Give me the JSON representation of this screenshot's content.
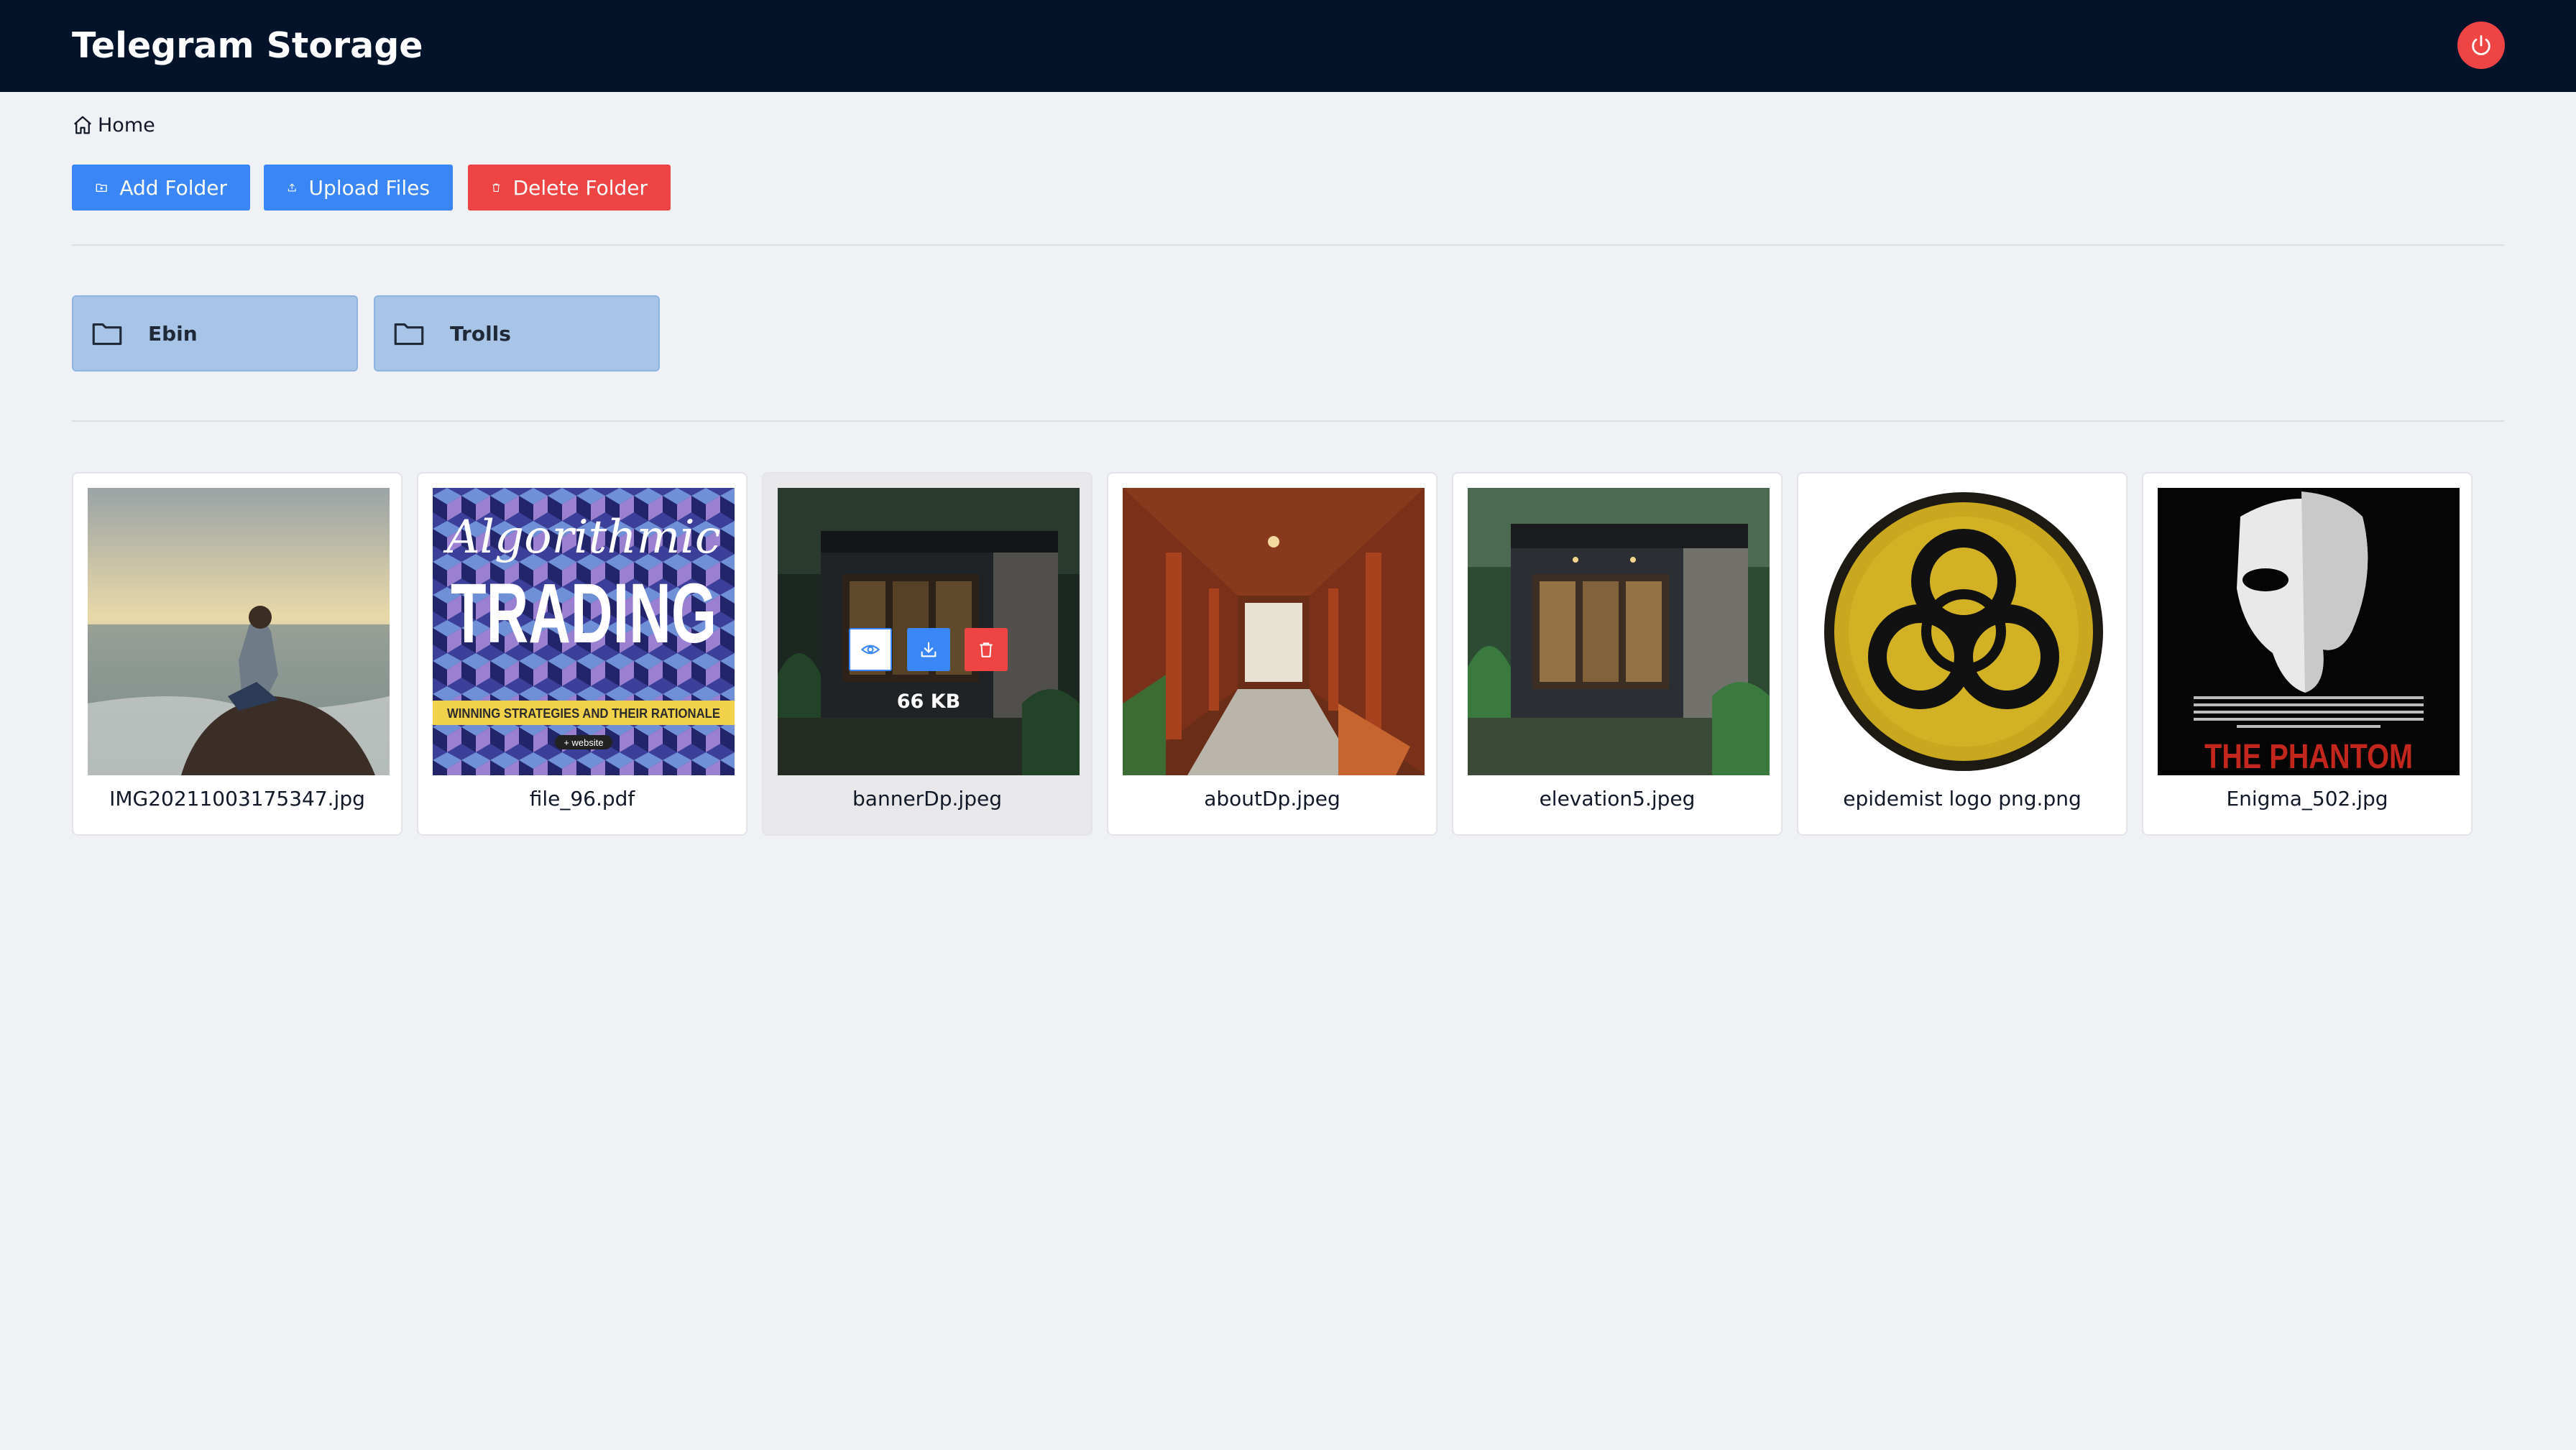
{
  "header": {
    "title": "Telegram Storage",
    "logout_icon": "power-icon"
  },
  "breadcrumb": {
    "icon": "home-icon",
    "label": "Home"
  },
  "toolbar": {
    "add_folder": "Add Folder",
    "upload_files": "Upload Files",
    "delete_folder": "Delete Folder"
  },
  "folders": [
    {
      "name": "Ebin",
      "icon": "folder-icon"
    },
    {
      "name": "Trolls",
      "icon": "folder-icon"
    }
  ],
  "files": [
    {
      "name": "IMG20211003175347.jpg"
    },
    {
      "name": "file_96.pdf",
      "thumb_text": [
        "Algorithmic",
        "TRADING",
        "WINNING STRATEGIES AND THEIR RATIONALE",
        "+ website"
      ]
    },
    {
      "name": "bannerDp.jpeg",
      "size": "66 KB",
      "hovered": true
    },
    {
      "name": "aboutDp.jpeg"
    },
    {
      "name": "elevation5.jpeg"
    },
    {
      "name": "epidemist logo png.png"
    },
    {
      "name": "Enigma_502.jpg",
      "thumb_text": [
        "THE PHANTOM"
      ]
    }
  ],
  "colors": {
    "header_bg": "#03142a",
    "primary": "#3b86f6",
    "danger": "#ef4444",
    "folder_bg": "#a8c5e8"
  }
}
